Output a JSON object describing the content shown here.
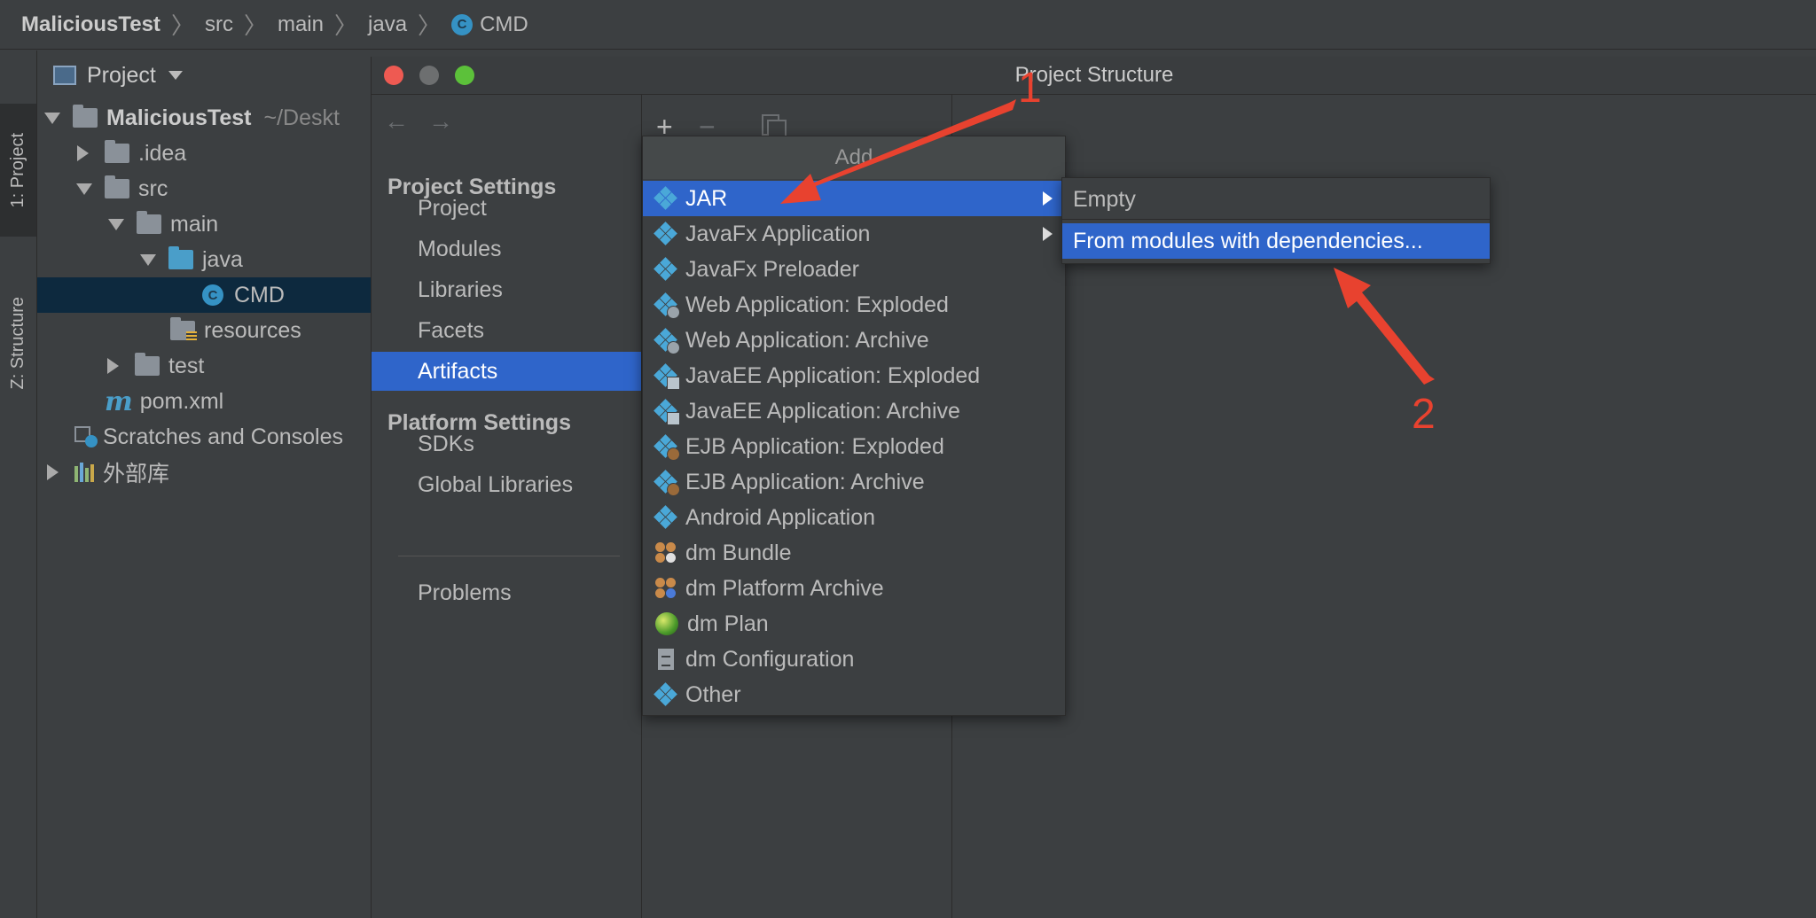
{
  "breadcrumb": {
    "items": [
      "MaliciousTest",
      "src",
      "main",
      "java",
      "CMD"
    ],
    "class_icon_letter": "C"
  },
  "tool_stripe": {
    "project_tab": "1: Project",
    "structure_tab": "Z: Structure"
  },
  "project_panel": {
    "header": "Project",
    "tree": [
      {
        "label": "MaliciousTest",
        "hint": "~/Deskt"
      },
      {
        "label": ".idea"
      },
      {
        "label": "src"
      },
      {
        "label": "main"
      },
      {
        "label": "java"
      },
      {
        "label": "CMD"
      },
      {
        "label": "resources"
      },
      {
        "label": "test"
      },
      {
        "label": "pom.xml"
      },
      {
        "label": "Scratches and Consoles"
      },
      {
        "label": "外部库"
      }
    ]
  },
  "dialog": {
    "title": "Project Structure",
    "nav": {
      "project_settings_header": "Project Settings",
      "project_settings_items": [
        "Project",
        "Modules",
        "Libraries",
        "Facets",
        "Artifacts"
      ],
      "platform_settings_header": "Platform Settings",
      "platform_settings_items": [
        "SDKs",
        "Global Libraries"
      ],
      "problems": "Problems"
    },
    "toolbar": {
      "add": "+",
      "remove": "−"
    }
  },
  "add_menu": {
    "header": "Add",
    "items": [
      "JAR",
      "JavaFx Application",
      "JavaFx Preloader",
      "Web Application: Exploded",
      "Web Application: Archive",
      "JavaEE Application: Exploded",
      "JavaEE Application: Archive",
      "EJB Application: Exploded",
      "EJB Application: Archive",
      "Android Application",
      "dm Bundle",
      "dm Platform Archive",
      "dm Plan",
      "dm Configuration",
      "Other"
    ]
  },
  "sub_menu": {
    "items": [
      "Empty",
      "From modules with dependencies..."
    ]
  },
  "annotations": {
    "step1": "1",
    "step2": "2",
    "color": "#e8422f"
  },
  "colors": {
    "background": "#3c3f41",
    "selection": "#2f65ca",
    "tree_selection": "#0d293e"
  }
}
